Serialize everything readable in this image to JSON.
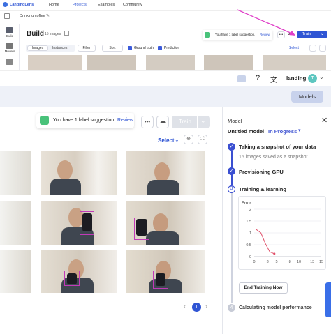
{
  "top_nav": {
    "brand": "LandingLens",
    "links": [
      "Home",
      "Projects",
      "Examples",
      "Community"
    ]
  },
  "project": {
    "name": "Drinking coffee"
  },
  "rail": {
    "items": [
      "Build",
      "Models",
      ""
    ]
  },
  "build_header": {
    "title": "Build",
    "count": "15 images",
    "suggestion": "You have 1 label suggestion.",
    "review": "Review",
    "train": "Train"
  },
  "toolbar": {
    "tabs": [
      "Images",
      "Instances"
    ],
    "filter": "Filter",
    "sort": "Sort",
    "ground_truth": "Ground truth",
    "prediction": "Prediction",
    "select": "Select"
  },
  "account_bar": {
    "org": "landing",
    "avatar_letter": "T"
  },
  "models_button": "Models",
  "main_toolbar": {
    "suggestion": "You have 1 label suggestion.",
    "review": "Review",
    "more": "•••",
    "train": "Train",
    "select": "Select"
  },
  "pagination": {
    "current": "1"
  },
  "model_panel": {
    "heading": "Model",
    "model_name": "Untitled model",
    "status": "In Progress",
    "steps": [
      {
        "number": "",
        "title": "Taking a snapshot of your data",
        "detail": "15 images saved as a snapshot."
      },
      {
        "number": "",
        "title": "Provisioning GPU",
        "detail": ""
      },
      {
        "number": "3",
        "title": "Training & learning",
        "detail": ""
      },
      {
        "number": "4",
        "title": "Calculating model performance",
        "detail": ""
      }
    ],
    "chart_label": "Error",
    "end_button": "End Training Now"
  },
  "colors": {
    "accent": "#3a4fd1",
    "bbox": "#c23ab8",
    "annotation_arrow": "#e040c8",
    "error_curve": "#e0506a"
  },
  "chart_data": {
    "type": "line",
    "title": "",
    "ylabel": "Error",
    "xlabel": "",
    "x_ticks": [
      0,
      3,
      5,
      8,
      10,
      13,
      15
    ],
    "y_ticks": [
      0,
      0.5,
      1,
      1.5,
      2
    ],
    "xlim": [
      0,
      15
    ],
    "ylim": [
      0,
      2
    ],
    "series": [
      {
        "x": [
          0.4,
          1.5,
          2.5,
          3.5,
          4.5
        ],
        "y": [
          1.15,
          1.0,
          0.55,
          0.2,
          0.12
        ]
      }
    ]
  }
}
